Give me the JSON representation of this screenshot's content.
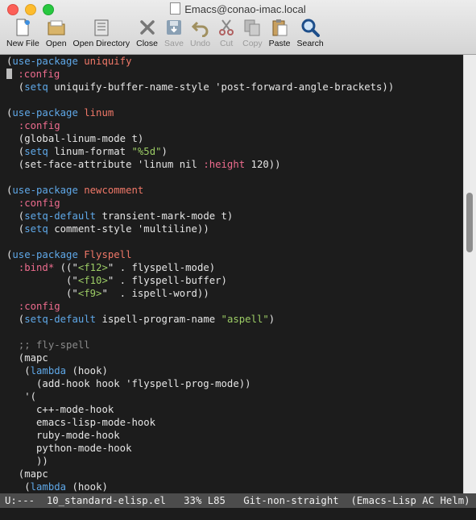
{
  "window": {
    "title": "Emacs@conao-imac.local"
  },
  "toolbar": [
    {
      "label": "New File",
      "icon": "new-file-icon",
      "enabled": true
    },
    {
      "label": "Open",
      "icon": "open-folder-icon",
      "enabled": true
    },
    {
      "label": "Open Directory",
      "icon": "open-directory-icon",
      "enabled": true
    },
    {
      "label": "Close",
      "icon": "close-icon",
      "enabled": true
    },
    {
      "label": "Save",
      "icon": "save-icon",
      "enabled": false
    },
    {
      "label": "Undo",
      "icon": "undo-icon",
      "enabled": false
    },
    {
      "label": "Cut",
      "icon": "cut-icon",
      "enabled": false
    },
    {
      "label": "Copy",
      "icon": "copy-icon",
      "enabled": false
    },
    {
      "label": "Paste",
      "icon": "paste-icon",
      "enabled": true
    },
    {
      "label": "Search",
      "icon": "search-icon",
      "enabled": true
    }
  ],
  "editor": {
    "lines": [
      [
        [
          "p",
          "("
        ],
        [
          "k",
          "use-package"
        ],
        [
          "p",
          " "
        ],
        [
          "n",
          "uniquify"
        ]
      ],
      [
        [
          "c",
          ""
        ],
        [
          "p",
          " "
        ],
        [
          "y",
          ":config"
        ]
      ],
      [
        [
          "p",
          "  ("
        ],
        [
          "k",
          "setq"
        ],
        [
          "p",
          " uniquify-buffer-name-style 'post-forward-angle-brackets))"
        ]
      ],
      [
        [
          "p",
          ""
        ]
      ],
      [
        [
          "p",
          "("
        ],
        [
          "k",
          "use-package"
        ],
        [
          "p",
          " "
        ],
        [
          "n",
          "linum"
        ]
      ],
      [
        [
          "p",
          "  "
        ],
        [
          "y",
          ":config"
        ]
      ],
      [
        [
          "p",
          "  (global-linum-mode t)"
        ]
      ],
      [
        [
          "p",
          "  ("
        ],
        [
          "k",
          "setq"
        ],
        [
          "p",
          " linum-format "
        ],
        [
          "s",
          "\"%5d\""
        ],
        [
          "p",
          ")"
        ]
      ],
      [
        [
          "p",
          "  (set-face-attribute 'linum nil "
        ],
        [
          "y",
          ":height"
        ],
        [
          "p",
          " 120))"
        ]
      ],
      [
        [
          "p",
          ""
        ]
      ],
      [
        [
          "p",
          "("
        ],
        [
          "k",
          "use-package"
        ],
        [
          "p",
          " "
        ],
        [
          "n",
          "newcomment"
        ]
      ],
      [
        [
          "p",
          "  "
        ],
        [
          "y",
          ":config"
        ]
      ],
      [
        [
          "p",
          "  ("
        ],
        [
          "k",
          "setq-default"
        ],
        [
          "p",
          " transient-mark-mode t)"
        ]
      ],
      [
        [
          "p",
          "  ("
        ],
        [
          "k",
          "setq"
        ],
        [
          "p",
          " comment-style 'multiline))"
        ]
      ],
      [
        [
          "p",
          ""
        ]
      ],
      [
        [
          "p",
          "("
        ],
        [
          "k",
          "use-package"
        ],
        [
          "p",
          " "
        ],
        [
          "n",
          "Flyspell"
        ]
      ],
      [
        [
          "p",
          "  "
        ],
        [
          "y",
          ":bind*"
        ],
        [
          "p",
          " ((\""
        ],
        [
          "s",
          "<f12>"
        ],
        [
          "p",
          "\" . flyspell-mode)"
        ]
      ],
      [
        [
          "p",
          "          (\""
        ],
        [
          "s",
          "<f10>"
        ],
        [
          "p",
          "\" . flyspell-buffer)"
        ]
      ],
      [
        [
          "p",
          "          (\""
        ],
        [
          "s",
          "<f9>"
        ],
        [
          "p",
          "\"  . ispell-word))"
        ]
      ],
      [
        [
          "p",
          "  "
        ],
        [
          "y",
          ":config"
        ]
      ],
      [
        [
          "p",
          "  ("
        ],
        [
          "k",
          "setq-default"
        ],
        [
          "p",
          " ispell-program-name "
        ],
        [
          "s",
          "\"aspell\""
        ],
        [
          "p",
          ")"
        ]
      ],
      [
        [
          "p",
          ""
        ]
      ],
      [
        [
          "p",
          "  "
        ],
        [
          "m",
          ";; fly-spell"
        ]
      ],
      [
        [
          "p",
          "  (mapc"
        ]
      ],
      [
        [
          "p",
          "   ("
        ],
        [
          "k",
          "lambda"
        ],
        [
          "p",
          " (hook)"
        ]
      ],
      [
        [
          "p",
          "     (add-hook hook 'flyspell-prog-mode))"
        ]
      ],
      [
        [
          "p",
          "   '("
        ]
      ],
      [
        [
          "p",
          "     c++-mode-hook"
        ]
      ],
      [
        [
          "p",
          "     emacs-lisp-mode-hook"
        ]
      ],
      [
        [
          "p",
          "     ruby-mode-hook"
        ]
      ],
      [
        [
          "p",
          "     python-mode-hook"
        ]
      ],
      [
        [
          "p",
          "     ))"
        ]
      ],
      [
        [
          "p",
          "  (mapc"
        ]
      ],
      [
        [
          "p",
          "   ("
        ],
        [
          "k",
          "lambda"
        ],
        [
          "p",
          " (hook)"
        ]
      ]
    ]
  },
  "modeline": {
    "status": "U:---",
    "buffer": "10_standard-elisp.el",
    "position": "33% L85",
    "vcs": "Git-non-straight",
    "modes": "(Emacs-Lisp AC Helm)"
  },
  "scrollbar": {
    "position_fraction": 0.33
  }
}
